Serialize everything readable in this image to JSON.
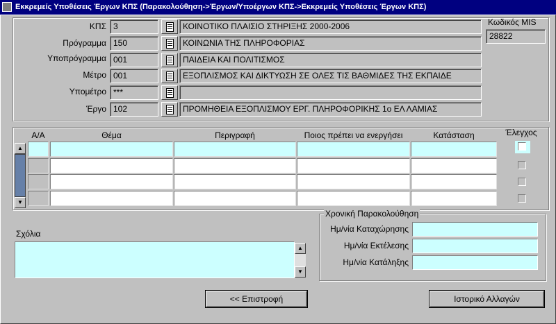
{
  "window": {
    "title": "Εκκρεμείς Υποθέσεις Έργων ΚΠΣ (Παρακολούθηση->Έργων/Υποέργων ΚΠΣ->Εκκρεμείς Υποθέσεις Έργων ΚΠΣ)"
  },
  "header_fields": [
    {
      "label": "ΚΠΣ",
      "code": "3",
      "description": "ΚΟΙΝΟΤΙΚΟ ΠΛΑΙΣΙΟ ΣΤΗΡΙΞΗΣ 2000-2006"
    },
    {
      "label": "Πρόγραμμα",
      "code": "150",
      "description": "ΚΟΙΝΩΝΙΑ ΤΗΣ ΠΛΗΡΟΦΟΡΙΑΣ"
    },
    {
      "label": "Υποπρόγραμμα",
      "code": "001",
      "description": "ΠΑΙΔΕΙΑ ΚΑΙ ΠΟΛΙΤΙΣΜΟΣ"
    },
    {
      "label": "Μέτρο",
      "code": "001",
      "description": "ΕΞΟΠΛΙΣΜΟΣ ΚΑΙ ΔΙΚΤΥΩΣΗ ΣΕ ΟΛΕΣ ΤΙΣ ΒΑΘΜΙΔΕΣ ΤΗΣ ΕΚΠΑΙΔΕ"
    },
    {
      "label": "Υπομέτρο",
      "code": "***",
      "description": ""
    },
    {
      "label": "Έργο",
      "code": "102",
      "description": "ΠΡΟΜΗΘΕΙΑ ΕΞΟΠΛΙΣΜΟΥ ΕΡΓ. ΠΛΗΡΟΦΟΡΙΚΗΣ 1ο ΕΛ ΛΑΜΙΑΣ"
    }
  ],
  "mis": {
    "label": "Κωδικός MIS",
    "value": "28822"
  },
  "grid": {
    "headers": {
      "aa": "Α/Α",
      "thema": "Θέμα",
      "perigrafi": "Περιγραφή",
      "poios": "Ποιος πρέπει να ενεργήσει",
      "katastasi": "Κατάσταση",
      "elegxos": "Έλεγχος"
    },
    "rows": 4
  },
  "comments": {
    "label": "Σχόλια",
    "value": ""
  },
  "timeline": {
    "title": "Χρονική Παρακολούθηση",
    "fields": [
      {
        "label": "Ημ/νία Καταχώρησης",
        "value": ""
      },
      {
        "label": "Ημ/νία Εκτέλεσης",
        "value": ""
      },
      {
        "label": "Ημ/νία Κατάληξης",
        "value": ""
      }
    ]
  },
  "buttons": {
    "back": "<< Επιστροφή",
    "history": "Ιστορικό Αλλαγών"
  },
  "icons": {
    "lov": "list-of-values-icon",
    "scroll_up": "▲",
    "scroll_down": "▼"
  }
}
